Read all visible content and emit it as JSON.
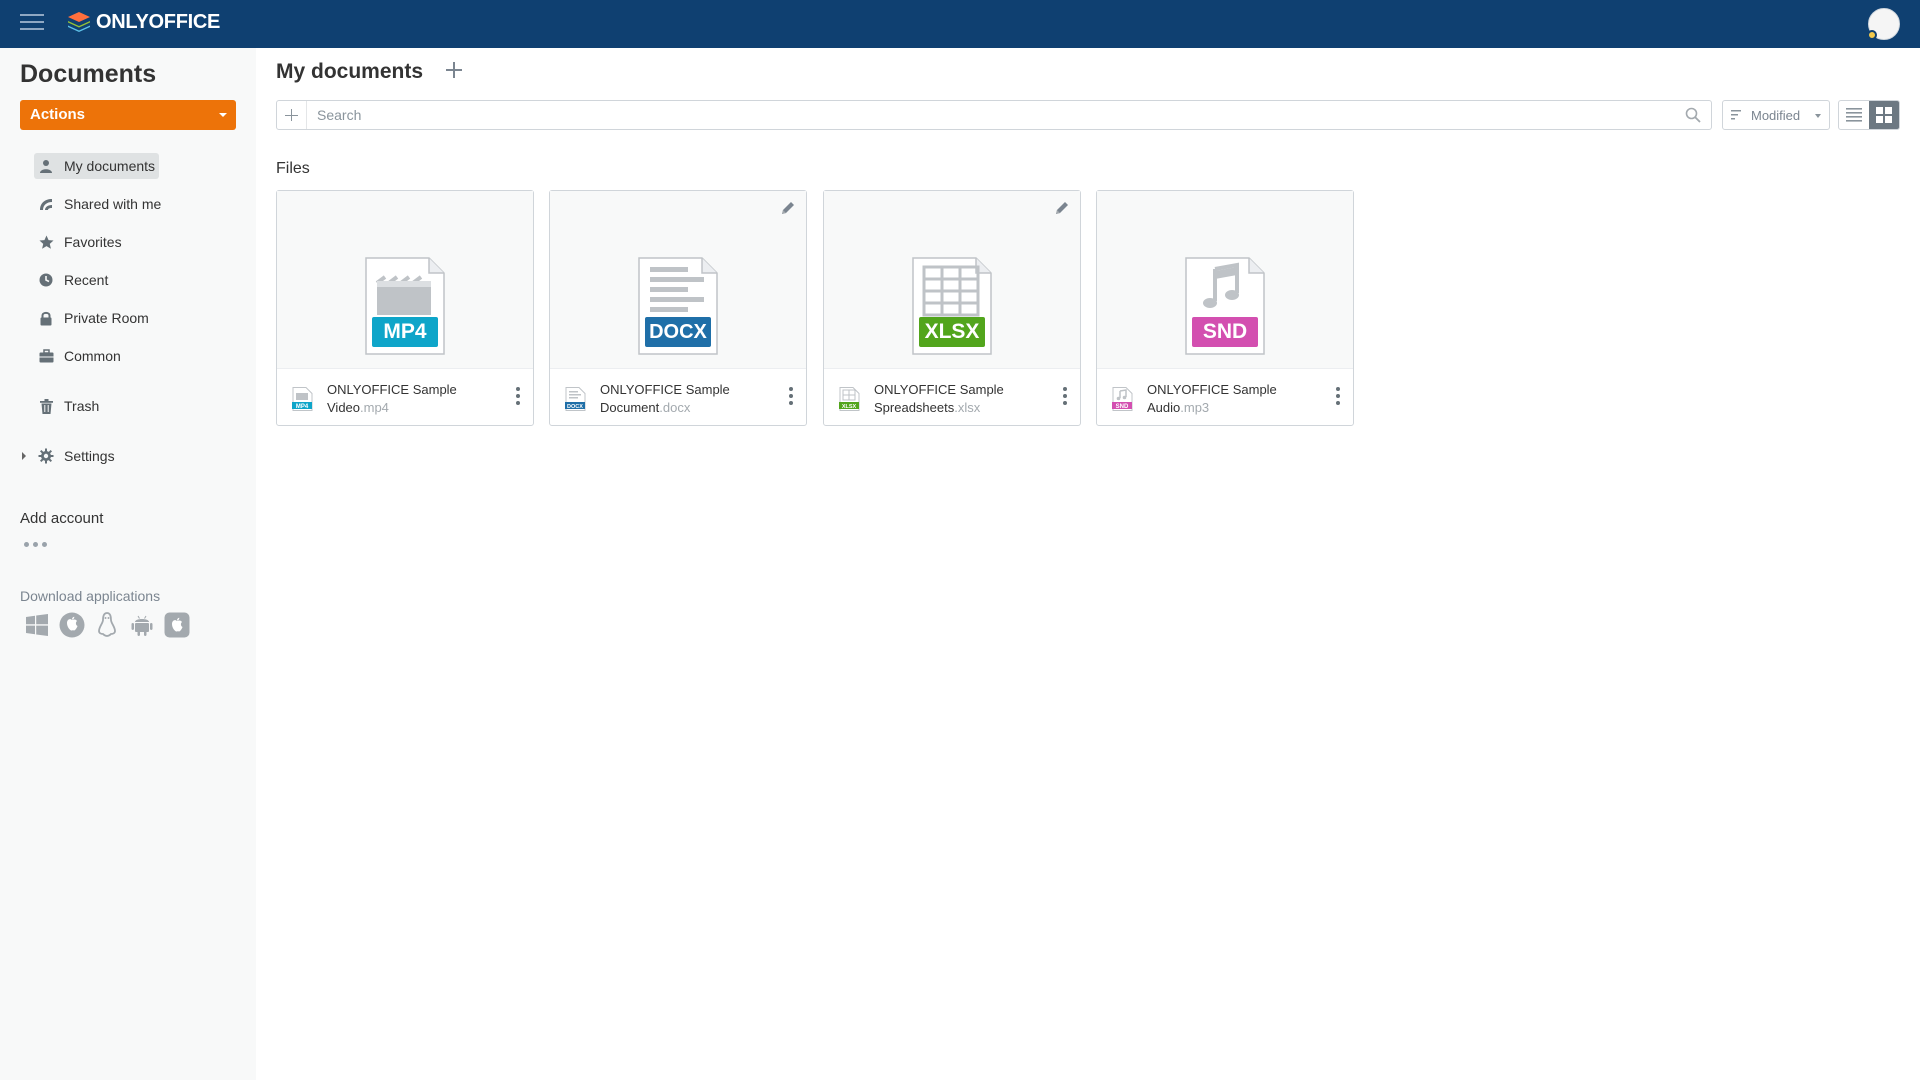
{
  "header": {
    "logo_text": "ONLYOFFICE",
    "brand_color": "#0f4071"
  },
  "sidebar": {
    "title": "Documents",
    "actions_label": "Actions",
    "actions_color": "#ed7309",
    "items": [
      {
        "label": "My documents",
        "icon": "person-icon",
        "active": true
      },
      {
        "label": "Shared with me",
        "icon": "share-icon",
        "active": false
      },
      {
        "label": "Favorites",
        "icon": "star-icon",
        "active": false
      },
      {
        "label": "Recent",
        "icon": "clock-icon",
        "active": false
      },
      {
        "label": "Private Room",
        "icon": "lock-icon",
        "active": false
      },
      {
        "label": "Common",
        "icon": "briefcase-icon",
        "active": false
      },
      {
        "label": "Trash",
        "icon": "trash-icon",
        "active": false
      },
      {
        "label": "Settings",
        "icon": "gear-icon",
        "active": false
      }
    ],
    "add_account": "Add account",
    "download_label": "Download applications",
    "download_icons": [
      "windows-icon",
      "macos-icon",
      "linux-icon",
      "android-icon",
      "ios-icon"
    ]
  },
  "main": {
    "title": "My documents",
    "search_placeholder": "Search",
    "sort_label": "Modified",
    "view_mode": "grid",
    "section_label": "Files",
    "files": [
      {
        "name": "ONLYOFFICE Sample Video",
        "ext": ".mp4",
        "badge": "MP4",
        "badge_color": "#0ea5c9",
        "editable": false
      },
      {
        "name": "ONLYOFFICE Sample Document",
        "ext": ".docx",
        "badge": "DOCX",
        "badge_color": "#1f6fa8",
        "editable": true
      },
      {
        "name": "ONLYOFFICE Sample Spreadsheets",
        "ext": ".xlsx",
        "badge": "XLSX",
        "badge_color": "#52a51c",
        "editable": true
      },
      {
        "name": "ONLYOFFICE Sample Audio",
        "ext": ".mp3",
        "badge": "SND",
        "badge_color": "#d34fb0",
        "editable": false
      }
    ]
  }
}
